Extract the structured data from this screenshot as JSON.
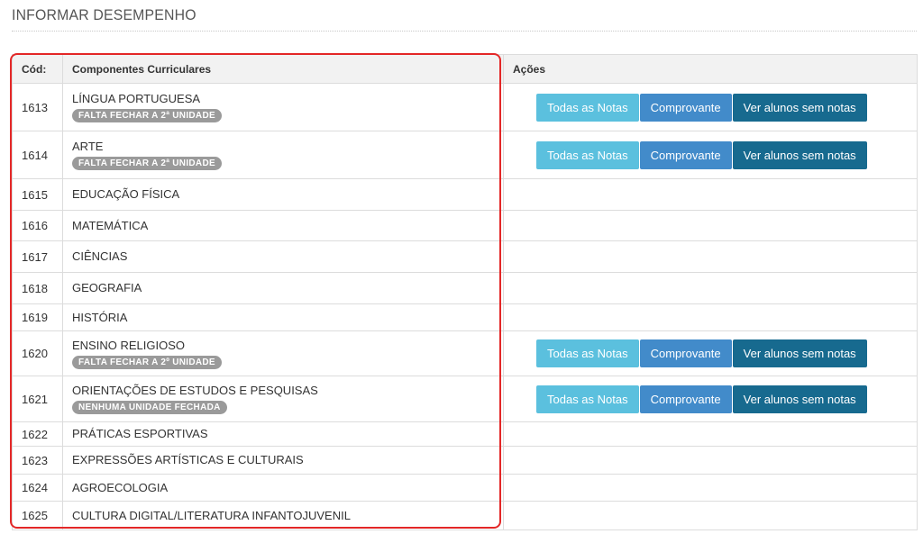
{
  "page": {
    "title": "INFORMAR DESEMPENHO"
  },
  "table": {
    "headers": {
      "code": "Cód:",
      "component": "Componentes Curriculares",
      "actions": "Ações"
    },
    "buttons": {
      "all_grades": "Todas as Notas",
      "receipt": "Comprovante",
      "no_grades": "Ver alunos sem notas"
    },
    "rows": [
      {
        "code": "1613",
        "name": "LÍNGUA PORTUGUESA",
        "badge": "FALTA FECHAR A 2ª UNIDADE",
        "has_actions": true
      },
      {
        "code": "1614",
        "name": "ARTE",
        "badge": "FALTA FECHAR A 2ª UNIDADE",
        "has_actions": true
      },
      {
        "code": "1615",
        "name": "EDUCAÇÃO FÍSICA",
        "badge": "",
        "has_actions": false
      },
      {
        "code": "1616",
        "name": "MATEMÁTICA",
        "badge": "",
        "has_actions": false
      },
      {
        "code": "1617",
        "name": "CIÊNCIAS",
        "badge": "",
        "has_actions": false
      },
      {
        "code": "1618",
        "name": "GEOGRAFIA",
        "badge": "",
        "has_actions": false
      },
      {
        "code": "1619",
        "name": "HISTÓRIA",
        "badge": "",
        "has_actions": false
      },
      {
        "code": "1620",
        "name": "ENSINO RELIGIOSO",
        "badge": "FALTA FECHAR A 2º UNIDADE",
        "has_actions": true
      },
      {
        "code": "1621",
        "name": "ORIENTAÇÕES DE ESTUDOS E PESQUISAS",
        "badge": "NENHUMA UNIDADE FECHADA",
        "has_actions": true
      },
      {
        "code": "1622",
        "name": "PRÁTICAS ESPORTIVAS",
        "badge": "",
        "has_actions": false
      },
      {
        "code": "1623",
        "name": "EXPRESSÕES ARTÍSTICAS E CULTURAIS",
        "badge": "",
        "has_actions": false
      },
      {
        "code": "1624",
        "name": "AGROECOLOGIA",
        "badge": "",
        "has_actions": false
      },
      {
        "code": "1625",
        "name": "CULTURA DIGITAL/LITERATURA INFANTOJUVENIL",
        "badge": "",
        "has_actions": false
      }
    ]
  },
  "colors": {
    "highlight_border": "#e32727",
    "btn_all_grades": "#5bc0de",
    "btn_receipt": "#428bca",
    "btn_no_grades": "#176a8f",
    "badge": "#9a9a9a"
  }
}
